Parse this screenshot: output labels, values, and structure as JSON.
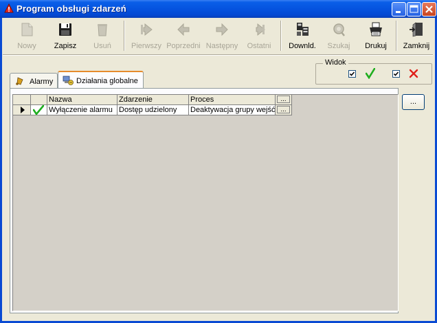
{
  "window": {
    "title": "Program obsługi zdarzeń"
  },
  "toolbar": {
    "items": [
      {
        "id": "nowy",
        "label": "Nowy",
        "icon": "new-document-icon",
        "enabled": false
      },
      {
        "id": "zapisz",
        "label": "Zapisz",
        "icon": "floppy-disk-icon",
        "enabled": true
      },
      {
        "id": "usun",
        "label": "Usuń",
        "icon": "trash-icon",
        "enabled": false
      },
      {
        "id": "pierwszy",
        "label": "Pierwszy",
        "icon": "first-record-icon",
        "enabled": false
      },
      {
        "id": "poprzedni",
        "label": "Poprzedni",
        "icon": "previous-record-icon",
        "enabled": false
      },
      {
        "id": "nastepny",
        "label": "Następny",
        "icon": "next-record-icon",
        "enabled": false
      },
      {
        "id": "ostatni",
        "label": "Ostatni",
        "icon": "last-record-icon",
        "enabled": false
      },
      {
        "id": "downld",
        "label": "Downld.",
        "icon": "download-icon",
        "enabled": true
      },
      {
        "id": "szukaj",
        "label": "Szukaj",
        "icon": "search-icon",
        "enabled": false
      },
      {
        "id": "drukuj",
        "label": "Drukuj",
        "icon": "printer-icon",
        "enabled": true
      },
      {
        "id": "zamknij",
        "label": "Zamknij",
        "icon": "exit-door-icon",
        "enabled": true
      }
    ]
  },
  "widok": {
    "label": "Widok",
    "show_active": true,
    "show_inactive": true
  },
  "tabs": [
    {
      "label": "Alarmy",
      "icon": "alarm-bell-icon",
      "active": false
    },
    {
      "label": "Działania globalne",
      "icon": "global-actions-icon",
      "active": true
    }
  ],
  "grid": {
    "columns": [
      "Nazwa",
      "Zdarzenie",
      "Proces"
    ],
    "header_button": "...",
    "rows": [
      {
        "enabled": true,
        "nazwa": "Wyłączenie alarmu",
        "zdarzenie": "Dostęp udzielony",
        "proces": "Deaktywacja grupy wejść",
        "button": "..."
      }
    ]
  },
  "side_button": "...",
  "colors": {
    "titlebar": "#0553df",
    "check_green": "#1fae1f",
    "cross_red": "#e0201a"
  }
}
